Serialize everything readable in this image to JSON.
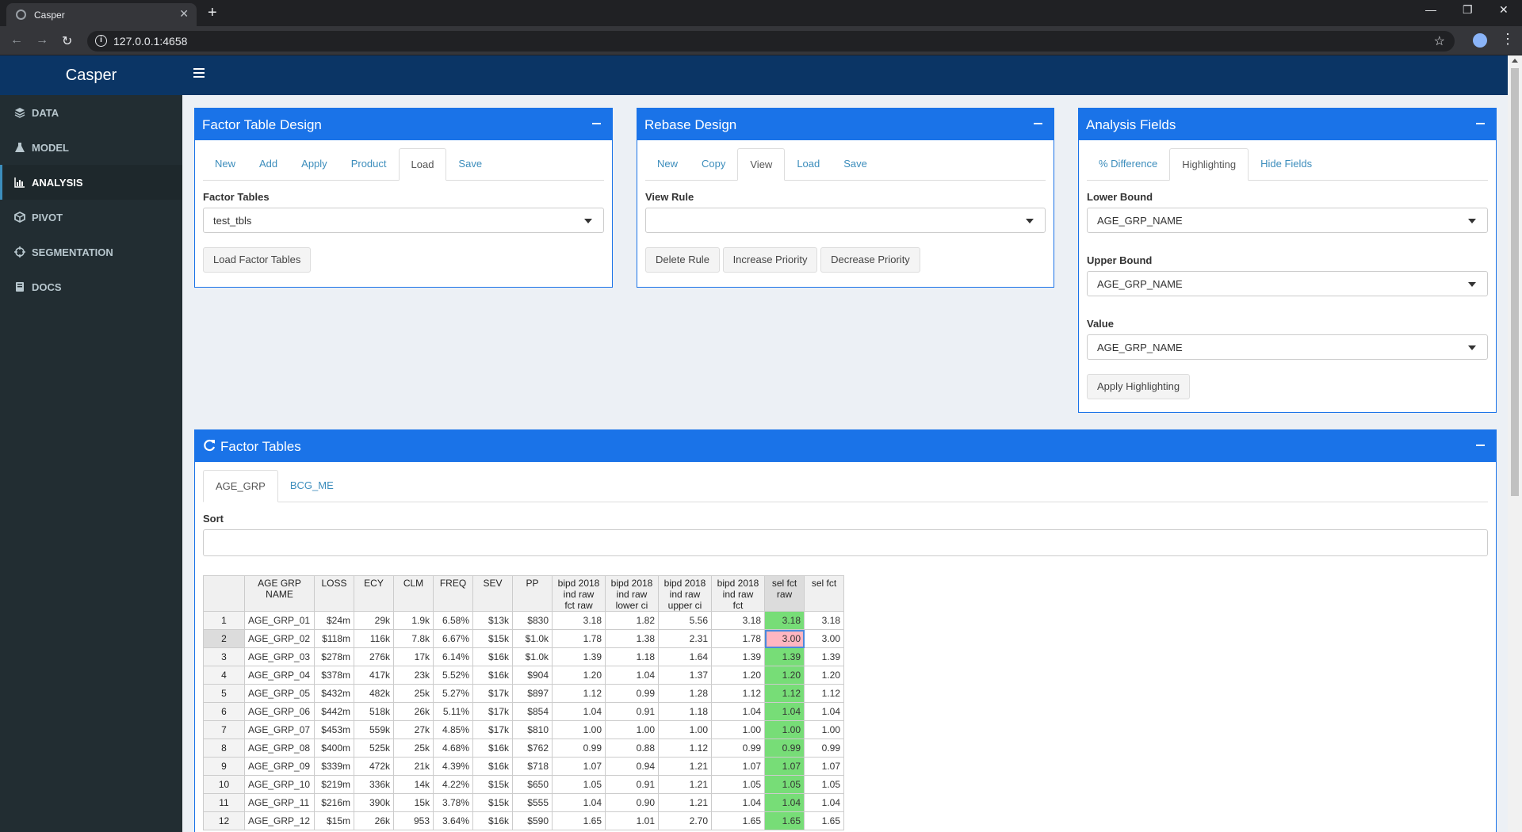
{
  "browser": {
    "tab_title": "Casper",
    "url": "127.0.0.1:4658"
  },
  "app": {
    "name": "Casper"
  },
  "sidebar": {
    "items": [
      {
        "label": "DATA",
        "icon": "layers-icon"
      },
      {
        "label": "MODEL",
        "icon": "flask-icon"
      },
      {
        "label": "ANALYSIS",
        "icon": "bar-chart-icon",
        "active": true
      },
      {
        "label": "PIVOT",
        "icon": "cube-icon"
      },
      {
        "label": "SEGMENTATION",
        "icon": "crosshairs-icon"
      },
      {
        "label": "DOCS",
        "icon": "book-icon"
      }
    ]
  },
  "factor_table_design": {
    "title": "Factor Table Design",
    "tabs": [
      "New",
      "Add",
      "Apply",
      "Product",
      "Load",
      "Save"
    ],
    "active_tab": "Load",
    "field_label": "Factor Tables",
    "selected": "test_tbls",
    "button": "Load Factor Tables"
  },
  "rebase_design": {
    "title": "Rebase Design",
    "tabs": [
      "New",
      "Copy",
      "View",
      "Load",
      "Save"
    ],
    "active_tab": "View",
    "field_label": "View Rule",
    "selected": "",
    "buttons": [
      "Delete Rule",
      "Increase Priority",
      "Decrease Priority"
    ]
  },
  "analysis_fields": {
    "title": "Analysis Fields",
    "tabs": [
      "% Difference",
      "Highlighting",
      "Hide Fields"
    ],
    "active_tab": "Highlighting",
    "lower_label": "Lower Bound",
    "lower_value": "AGE_GRP_NAME",
    "upper_label": "Upper Bound",
    "upper_value": "AGE_GRP_NAME",
    "value_label": "Value",
    "value_value": "AGE_GRP_NAME",
    "button": "Apply Highlighting"
  },
  "factor_tables": {
    "title": "Factor Tables",
    "tabs": [
      "AGE_GRP",
      "BCG_ME"
    ],
    "active_tab": "AGE_GRP",
    "sort_label": "Sort",
    "columns": [
      [
        "AGE GRP",
        "NAME"
      ],
      [
        "LOSS"
      ],
      [
        "ECY"
      ],
      [
        "CLM"
      ],
      [
        "FREQ"
      ],
      [
        "SEV"
      ],
      [
        "PP"
      ],
      [
        "bipd 2018",
        "ind raw",
        "fct raw"
      ],
      [
        "bipd 2018",
        "ind raw",
        "lower ci"
      ],
      [
        "bipd 2018",
        "ind raw",
        "upper ci"
      ],
      [
        "bipd 2018",
        "ind raw",
        "fct"
      ],
      [
        "sel fct",
        "raw"
      ],
      [
        "sel fct"
      ]
    ],
    "rows": [
      [
        "1",
        "AGE_GRP_01",
        "$24m",
        "29k",
        "1.9k",
        "6.58%",
        "$13k",
        "$830",
        "3.18",
        "1.82",
        "5.56",
        "3.18",
        "3.18",
        "3.18"
      ],
      [
        "2",
        "AGE_GRP_02",
        "$118m",
        "116k",
        "7.8k",
        "6.67%",
        "$15k",
        "$1.0k",
        "1.78",
        "1.38",
        "2.31",
        "1.78",
        "3.00",
        "3.00"
      ],
      [
        "3",
        "AGE_GRP_03",
        "$278m",
        "276k",
        "17k",
        "6.14%",
        "$16k",
        "$1.0k",
        "1.39",
        "1.18",
        "1.64",
        "1.39",
        "1.39",
        "1.39"
      ],
      [
        "4",
        "AGE_GRP_04",
        "$378m",
        "417k",
        "23k",
        "5.52%",
        "$16k",
        "$904",
        "1.20",
        "1.04",
        "1.37",
        "1.20",
        "1.20",
        "1.20"
      ],
      [
        "5",
        "AGE_GRP_05",
        "$432m",
        "482k",
        "25k",
        "5.27%",
        "$17k",
        "$897",
        "1.12",
        "0.99",
        "1.28",
        "1.12",
        "1.12",
        "1.12"
      ],
      [
        "6",
        "AGE_GRP_06",
        "$442m",
        "518k",
        "26k",
        "5.11%",
        "$17k",
        "$854",
        "1.04",
        "0.91",
        "1.18",
        "1.04",
        "1.04",
        "1.04"
      ],
      [
        "7",
        "AGE_GRP_07",
        "$453m",
        "559k",
        "27k",
        "4.85%",
        "$17k",
        "$810",
        "1.00",
        "1.00",
        "1.00",
        "1.00",
        "1.00",
        "1.00"
      ],
      [
        "8",
        "AGE_GRP_08",
        "$400m",
        "525k",
        "25k",
        "4.68%",
        "$16k",
        "$762",
        "0.99",
        "0.88",
        "1.12",
        "0.99",
        "0.99",
        "0.99"
      ],
      [
        "9",
        "AGE_GRP_09",
        "$339m",
        "472k",
        "21k",
        "4.39%",
        "$16k",
        "$718",
        "1.07",
        "0.94",
        "1.21",
        "1.07",
        "1.07",
        "1.07"
      ],
      [
        "10",
        "AGE_GRP_10",
        "$219m",
        "336k",
        "14k",
        "4.22%",
        "$15k",
        "$650",
        "1.05",
        "0.91",
        "1.21",
        "1.05",
        "1.05",
        "1.05"
      ],
      [
        "11",
        "AGE_GRP_11",
        "$216m",
        "390k",
        "15k",
        "3.78%",
        "$15k",
        "$555",
        "1.04",
        "0.90",
        "1.21",
        "1.04",
        "1.04",
        "1.04"
      ],
      [
        "12",
        "AGE_GRP_12",
        "$15m",
        "26k",
        "953",
        "3.64%",
        "$16k",
        "$590",
        "1.65",
        "1.01",
        "2.70",
        "1.65",
        "1.65",
        "1.65"
      ]
    ]
  }
}
